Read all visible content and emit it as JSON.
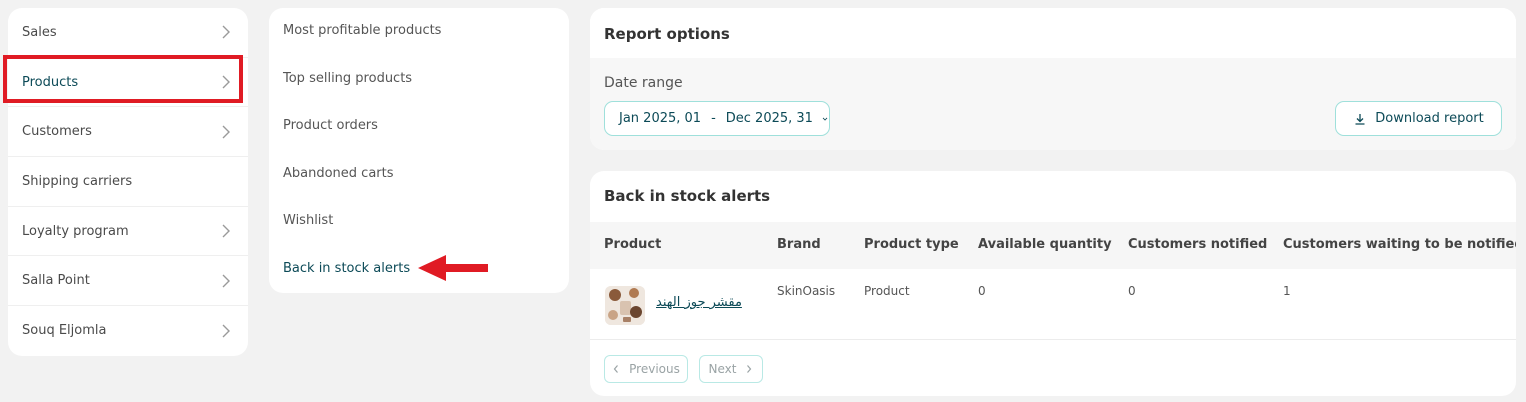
{
  "menu": {
    "items": [
      {
        "label": "Sales",
        "has_arrow": true
      },
      {
        "label": "Products",
        "has_arrow": true,
        "active": true
      },
      {
        "label": "Customers",
        "has_arrow": true
      },
      {
        "label": "Shipping carriers",
        "has_arrow": false
      },
      {
        "label": "Loyalty program",
        "has_arrow": true
      },
      {
        "label": "Salla Point",
        "has_arrow": true
      },
      {
        "label": "Souq Eljomla",
        "has_arrow": true
      }
    ],
    "chevron_icon": "chevron-right-icon"
  },
  "reports": {
    "items": [
      {
        "label": "Most profitable products"
      },
      {
        "label": "Top selling products"
      },
      {
        "label": "Product orders"
      },
      {
        "label": "Abandoned carts"
      },
      {
        "label": "Wishlist"
      },
      {
        "label": "Back in stock alerts",
        "active": true
      }
    ]
  },
  "options": {
    "title": "Report options",
    "date_label": "Date range",
    "date_start": "Jan 2025, 01",
    "date_separator": "-",
    "date_end": "Dec 2025, 31",
    "download_label": "Download report"
  },
  "results": {
    "title": "Back in stock alerts",
    "columns": [
      "Product",
      "Brand",
      "Product type",
      "Available quantity",
      "Customers notified",
      "Customers waiting to be notified"
    ],
    "rows": [
      {
        "product": "مقشر جوز الهند",
        "brand": "SkinOasis",
        "type": "Product",
        "available": "0",
        "notified": "0",
        "waiting": "1"
      }
    ],
    "prev_label": "Previous",
    "next_label": "Next"
  },
  "colors": {
    "accent": "#0c4a57",
    "border_accent": "#9fe0db",
    "highlight": "#e01b24",
    "background": "#f2f2f2"
  }
}
